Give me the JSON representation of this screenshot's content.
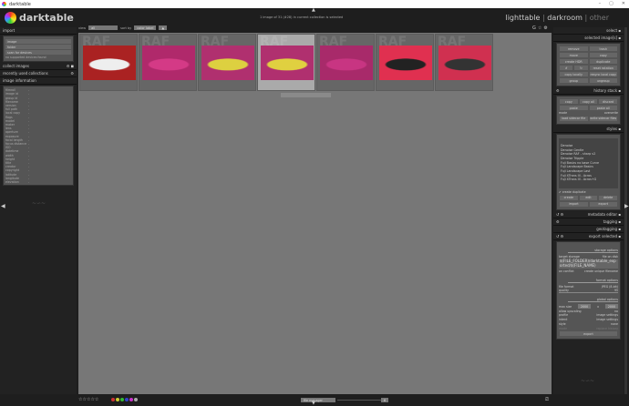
{
  "window": {
    "title": "darktable",
    "controls": [
      "–",
      "▢",
      "✕"
    ]
  },
  "brand": "darktable",
  "status": "1 image of 31 (#28) in current collection is selected",
  "views": {
    "lighttable": "lighttable",
    "darkroom": "darkroom",
    "other": "other",
    "sep": "|"
  },
  "filter": {
    "view_label": "view",
    "view_value": "all",
    "sort_label": "sort by",
    "sort_value": "color label",
    "sort_dir": "▲"
  },
  "left": {
    "import": {
      "title": "import",
      "buttons": [
        "image",
        "folder",
        "scan for devices"
      ],
      "note": "no supported devices found"
    },
    "collect": "collect images",
    "recent": "recently used collections",
    "info": {
      "title": "image information",
      "fields": [
        "filmroll",
        "image id",
        "group id",
        "filename",
        "version",
        "full path",
        "local copy",
        "flags",
        "model",
        "maker",
        "lens",
        "aperture",
        "exposure",
        "focal length",
        "focus distance",
        "ISO",
        "datetime",
        "width",
        "height",
        "title",
        "creator",
        "copyright",
        "latitude",
        "longitude",
        "elevation"
      ],
      "value": "-"
    },
    "script_manager": "script manager"
  },
  "thumbs": [
    {
      "label": "RAF",
      "colors": [
        "#a22",
        "#eee"
      ]
    },
    {
      "label": "RAF",
      "colors": [
        "#b0296b",
        "#d43a86"
      ]
    },
    {
      "label": "RAF",
      "colors": [
        "#b0306f",
        "#ddd040"
      ]
    },
    {
      "label": "RAF",
      "colors": [
        "#b0306f",
        "#e0d040"
      ],
      "selected": true
    },
    {
      "label": "RAF",
      "colors": [
        "#a82a6a",
        "#c83582"
      ]
    },
    {
      "label": "RAF",
      "colors": [
        "#e03050",
        "#222"
      ]
    },
    {
      "label": "RAF",
      "colors": [
        "#d03050",
        "#333"
      ]
    }
  ],
  "right": {
    "select": "select",
    "selected": {
      "title": "selected image[s]",
      "buttons": [
        "remove",
        "trash",
        "move",
        "copy",
        "create HDR",
        "duplicate",
        "↺",
        "↻",
        "reset rotation",
        "copy locally",
        "resync local copy",
        "group",
        "ungroup"
      ]
    },
    "history": {
      "title": "history stack",
      "buttons": [
        "copy",
        "copy all",
        "discard",
        "paste",
        "paste all"
      ],
      "mode_label": "mode",
      "mode_value": "overwrite",
      "load": "load sidecar file",
      "write": "write sidecar files"
    },
    "styles": {
      "title": "styles",
      "items": [
        "Denoise",
        "Denoise Gentle",
        "Denoise RAF - sharp v2",
        "Denoise Tripple",
        "Fuji Basics no base Curve",
        "Fuji Landscape Basics",
        "Fuji Landscape Last",
        "Fuji XTrans III - Acros",
        "Fuji XTrans III - Acros+G"
      ],
      "create_duplicate": "create duplicate",
      "buttons": [
        "create",
        "edit",
        "delete",
        "import",
        "export"
      ]
    },
    "metadata": "metadata editor",
    "tagging": "tagging",
    "geotagging": "geotagging",
    "export": {
      "title": "export selected",
      "storage": "storage options",
      "target_label": "target storage",
      "target_value": "file on disk",
      "path": "$(FILE_FOLDER)/darktable_exported/$(FILE_NAME)",
      "conflict_label": "on conflict",
      "conflict_value": "create unique filename",
      "format": "format options",
      "format_label": "file format",
      "format_value": "JPEG (8-bit)",
      "quality_label": "quality",
      "quality_value": "95",
      "global": "global options",
      "size_label": "max size",
      "w": "2000",
      "h": "2000",
      "x": "x",
      "upscale_label": "allow upscaling",
      "upscale_value": "no",
      "profile_label": "profile",
      "profile_value": "image settings",
      "intent_label": "intent",
      "intent_value": "image settings",
      "style_label": "style",
      "style_value": "none",
      "mode_label": "mode",
      "mode_value": "replace history",
      "button": "export"
    }
  },
  "bottom": {
    "stars": "☆☆☆☆☆",
    "labels": [
      "#c33",
      "#cc3",
      "#3b3",
      "#34c",
      "#c3c",
      "#aaa"
    ],
    "layout": "file manager",
    "zoom": "6"
  }
}
